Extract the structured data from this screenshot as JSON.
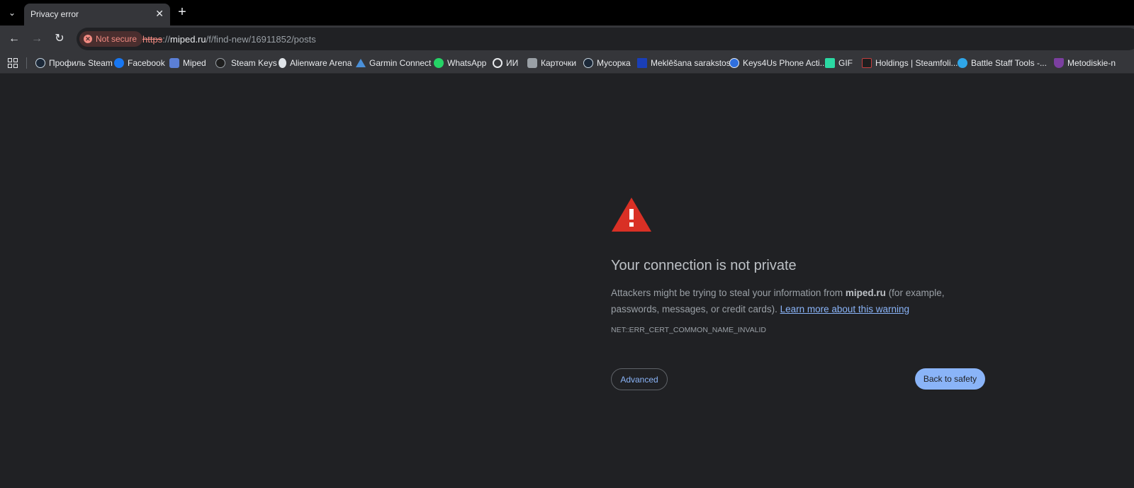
{
  "tab": {
    "title": "Privacy error",
    "close_glyph": "✕",
    "new_tab_glyph": "+",
    "search_glyph": "⌄"
  },
  "nav": {
    "back_glyph": "←",
    "forward_glyph": "→",
    "reload_glyph": "↻"
  },
  "omnibox": {
    "security_chip": "Not secure",
    "url_scheme": "https",
    "url_separator": "://",
    "url_host": "miped.ru",
    "url_path": "/f/find-new/16911852/posts"
  },
  "bookmarks": [
    {
      "label": "Профиль Steam",
      "icon": "steam-icon",
      "color": "#1b2838"
    },
    {
      "label": "Facebook",
      "icon": "facebook-icon",
      "color": "#1877f2"
    },
    {
      "label": "Miped",
      "icon": "miped-icon",
      "color": "#5b7fd6"
    },
    {
      "label": "Steam Keys",
      "icon": "key-icon",
      "color": "#1e1e1e"
    },
    {
      "label": "Alienware Arena",
      "icon": "alien-icon",
      "color": "#dfe3e8"
    },
    {
      "label": "Garmin Connect",
      "icon": "garmin-icon",
      "color": "#4a90d9"
    },
    {
      "label": "WhatsApp",
      "icon": "whatsapp-icon",
      "color": "#25d366"
    },
    {
      "label": "ИИ",
      "icon": "openai-icon",
      "color": "#e8eaed"
    },
    {
      "label": "Карточки",
      "icon": "cards-icon",
      "color": "#9aa0a6"
    },
    {
      "label": "Мусорка",
      "icon": "steam-icon",
      "color": "#1b2838"
    },
    {
      "label": "Meklēšana sarakstos",
      "icon": "list-icon",
      "color": "#1a3fb8"
    },
    {
      "label": "Keys4Us Phone Acti...",
      "icon": "keys4us-icon",
      "color": "#2f6fde"
    },
    {
      "label": "GIF",
      "icon": "gif-icon",
      "color": "#2bd9a3"
    },
    {
      "label": "Holdings | Steamfoli...",
      "icon": "steamfolio-icon",
      "color": "#c33f3f"
    },
    {
      "label": "Battle Staff Tools -...",
      "icon": "battle-icon",
      "color": "#2fa6e8"
    },
    {
      "label": "Metodiskie-n",
      "icon": "crest-icon",
      "color": "#7b3fa0"
    }
  ],
  "interstitial": {
    "headline": "Your connection is not private",
    "body_prefix": "Attackers might be trying to steal your information from",
    "body_host": "miped.ru",
    "body_suffix": "(for example, passwords, messages, or credit cards).",
    "learn_more": "Learn more about this warning",
    "error_code": "NET::ERR_CERT_COMMON_NAME_INVALID",
    "advanced_label": "Advanced",
    "back_label": "Back to safety",
    "warning_color": "#d93025"
  }
}
